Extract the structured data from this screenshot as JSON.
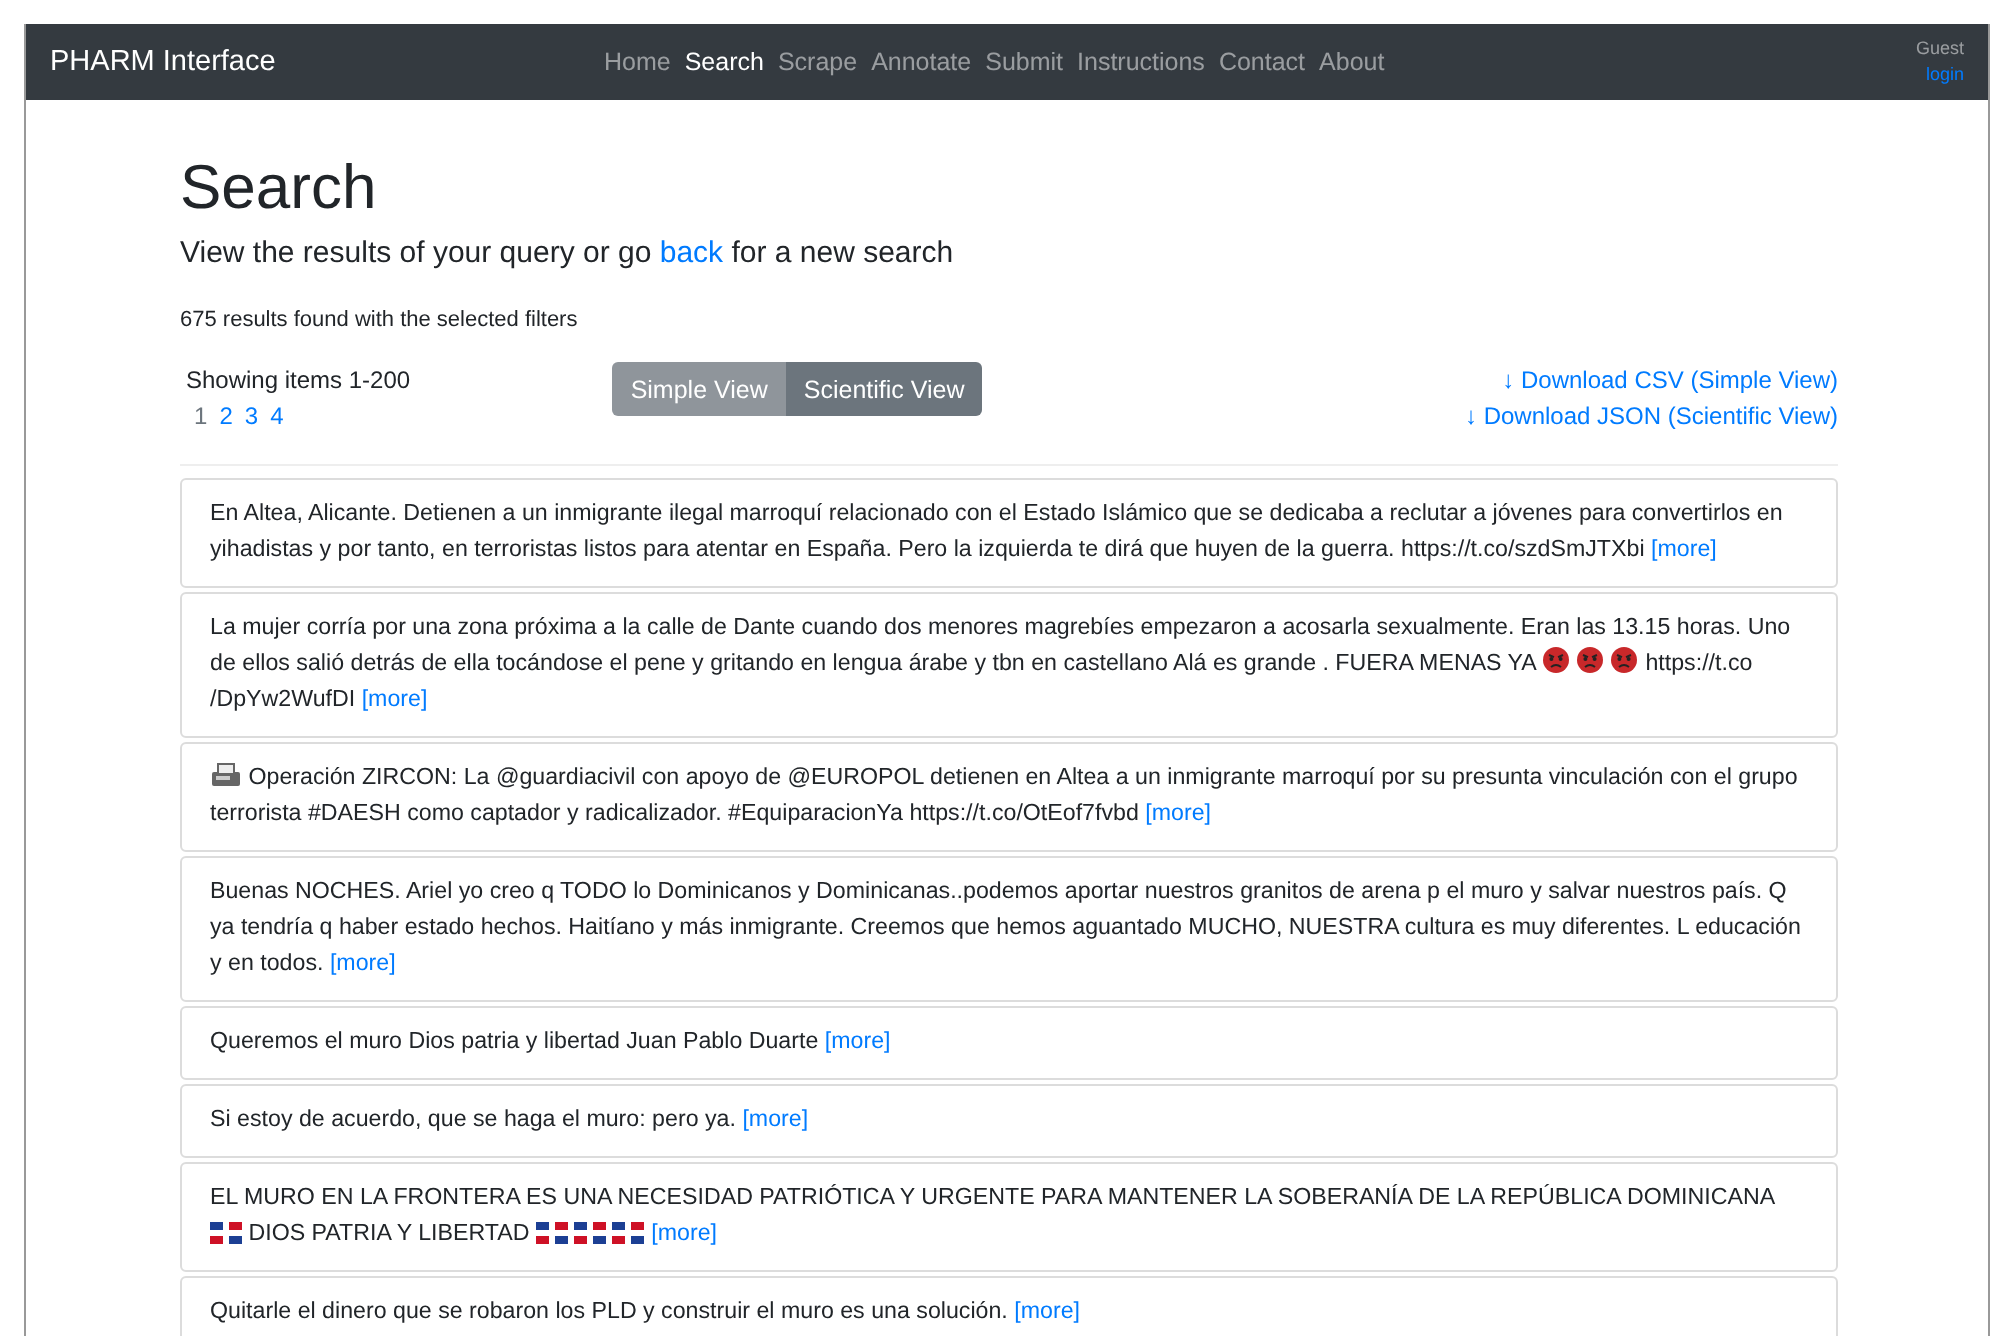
{
  "navbar": {
    "brand": "PHARM Interface",
    "links": [
      {
        "label": "Home",
        "selected": false
      },
      {
        "label": "Search",
        "selected": true
      },
      {
        "label": "Scrape",
        "selected": false
      },
      {
        "label": "Annotate",
        "selected": false
      },
      {
        "label": "Submit",
        "selected": false
      },
      {
        "label": "Instructions",
        "selected": false
      },
      {
        "label": "Contact",
        "selected": false
      },
      {
        "label": "About",
        "selected": false
      }
    ],
    "user": "Guest",
    "login": "login"
  },
  "page": {
    "title": "Search",
    "subtitle_before": "View the results of your query or go",
    "subtitle_link": "back",
    "subtitle_after": "for a new search",
    "result_count": "675 results found with the selected filters"
  },
  "pager": {
    "showing": "Showing items 1-200",
    "pages": [
      {
        "label": "1",
        "selected": true
      },
      {
        "label": "2",
        "selected": false
      },
      {
        "label": "3",
        "selected": false
      },
      {
        "label": "4",
        "selected": false
      }
    ]
  },
  "views": [
    {
      "label": "Simple View",
      "selected": false
    },
    {
      "label": "Scientific View",
      "selected": true
    }
  ],
  "downloads": [
    {
      "arrow": "↓",
      "label": "Download CSV (Simple View)"
    },
    {
      "arrow": "↓",
      "label": "Download JSON (Scientific View)"
    }
  ],
  "results": [
    {
      "segments": [
        {
          "kind": "text",
          "text": "En Altea, Alicante. Detienen a un inmigrante ilegal marroquí relacionado con el Estado Islámico que se dedicaba a reclutar a jóvenes para convertirlos en yihadistas y por tanto, en terroristas listos para atentar en España. Pero la izquierda te dirá que huyen de la guerra. https://t.co/szdSmJTXbi"
        }
      ],
      "more": "[more]"
    },
    {
      "segments": [
        {
          "kind": "text",
          "text": "La mujer corría por una zona próxima a la calle de Dante cuando dos menores magrebíes empezaron a acosarla sexualmente. Eran las 13.15 horas. Uno de ellos salió detrás de ella tocándose el pene y gritando en lengua árabe y tbn en castellano Alá es grande . FUERA MENAS YA"
        },
        {
          "kind": "face"
        },
        {
          "kind": "face"
        },
        {
          "kind": "face"
        },
        {
          "kind": "text",
          "text": "https://t.co /DpYw2WufDI"
        }
      ],
      "more": "[more]"
    },
    {
      "segments": [
        {
          "kind": "fax"
        },
        {
          "kind": "text",
          "text": "Operación ZIRCON: La @guardiacivil con apoyo de @EUROPOL detienen en Altea a un inmigrante marroquí por su presunta vinculación con el grupo terrorista #DAESH como captador y radicalizador. #EquiparacionYa https://t.co/OtEof7fvbd"
        }
      ],
      "more": "[more]"
    },
    {
      "segments": [
        {
          "kind": "text",
          "text": "Buenas NOCHES. Ariel yo creo q TODO lo Dominicanos y Dominicanas..podemos aportar nuestros granitos de arena p el muro y salvar nuestros país. Q ya tendría q haber estado hechos. Haitíano y más inmigrante. Creemos que hemos aguantado MUCHO, NUESTRA cultura es muy diferentes. L educación y en todos."
        }
      ],
      "more": "[more]"
    },
    {
      "segments": [
        {
          "kind": "text",
          "text": "Queremos el muro Dios patria y libertad Juan Pablo Duarte"
        }
      ],
      "more": "[more]"
    },
    {
      "segments": [
        {
          "kind": "text",
          "text": "Si estoy de acuerdo, que se haga el muro: pero ya."
        }
      ],
      "more": "[more]"
    },
    {
      "segments": [
        {
          "kind": "text",
          "text": "EL MURO EN LA FRONTERA ES UNA NECESIDAD PATRIÓTICA Y URGENTE PARA MANTENER LA SOBERANÍA DE LA REPÚBLICA DOMINICANA"
        },
        {
          "kind": "flag"
        },
        {
          "kind": "text",
          "text": "DIOS PATRIA Y LIBERTAD"
        },
        {
          "kind": "flag"
        },
        {
          "kind": "flag"
        },
        {
          "kind": "flag"
        }
      ],
      "more": "[more]"
    },
    {
      "segments": [
        {
          "kind": "text",
          "text": "Quitarle el dinero que se robaron los PLD y construir el muro es una solución."
        }
      ],
      "more": "[more]"
    }
  ]
}
